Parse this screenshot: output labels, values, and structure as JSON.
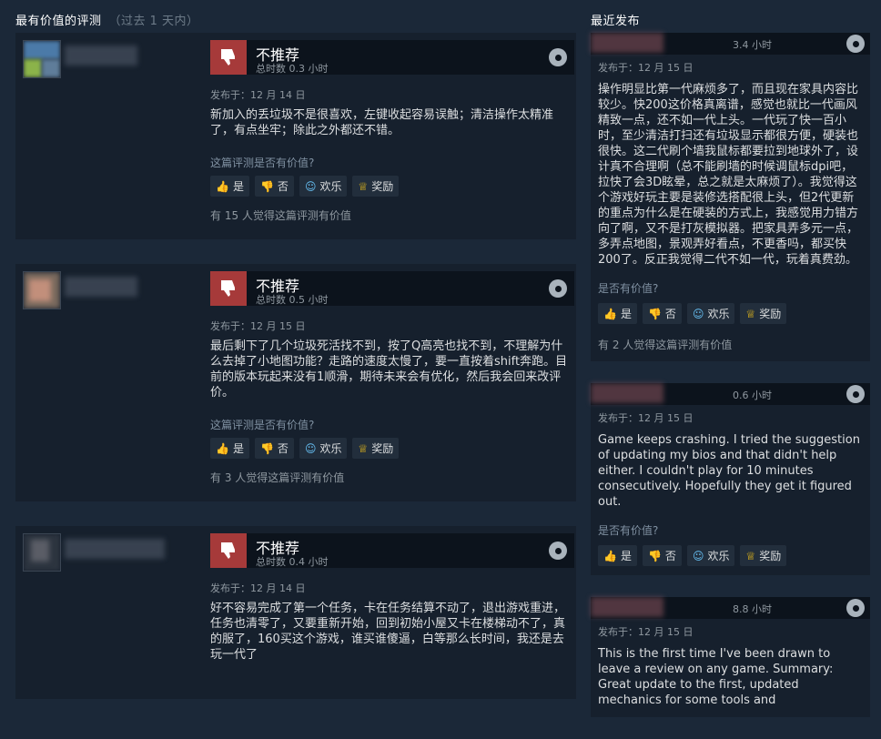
{
  "most_helpful": {
    "title": "最有价值的评测",
    "range": "（过去 1 天内）",
    "reviews": [
      {
        "verdict": "不推荐",
        "hours": "总时数 0.3 小时",
        "posted": "发布于：12 月 14 日",
        "text": "新加入的丢垃圾不是很喜欢，左键收起容易误触；清洁操作太精准了，有点坐牢；除此之外都还不错。",
        "found_helpful": "有 15 人觉得这篇评测有价值"
      },
      {
        "verdict": "不推荐",
        "hours": "总时数 0.5 小时",
        "posted": "发布于：12 月 15 日",
        "text": "最后剩下了几个垃圾死活找不到，按了Q高亮也找不到，不理解为什么去掉了小地图功能？走路的速度太慢了，要一直按着shift奔跑。目前的版本玩起来没有1顺滑，期待未来会有优化，然后我会回来改评价。",
        "found_helpful": "有 3 人觉得这篇评测有价值"
      },
      {
        "verdict": "不推荐",
        "hours": "总时数 0.4 小时",
        "posted": "发布于：12 月 14 日",
        "text": "好不容易完成了第一个任务，卡在任务结算不动了，退出游戏重进，任务也清零了，又要重新开始，回到初始小屋又卡在楼梯动不了，真的服了，160买这个游戏，谁买谁傻逼，白等那么长时间，我还是去玩一代了",
        "found_helpful": ""
      }
    ]
  },
  "recent": {
    "title": "最近发布",
    "reviews": [
      {
        "hours": "3.4 小时",
        "posted": "发布于：12 月 15 日",
        "text": "操作明显比第一代麻烦多了，而且现在家具内容比较少。快200这价格真离谱，感觉也就比一代画风精致一点，还不如一代上头。一代玩了快一百小时，至少清洁打扫还有垃圾显示都很方便，硬装也很快。这二代刷个墙我鼠标都要拉到地球外了，设计真不合理啊（总不能刷墙的时候调鼠标dpi吧，拉快了会3D眩晕，总之就是太麻烦了）。我觉得这个游戏好玩主要是装修选搭配很上头，但2代更新的重点为什么是在硬装的方式上，我感觉用力错方向了啊，又不是打灰模拟器。把家具弄多元一点，多弄点地图，景观弄好看点，不更香吗，都买快200了。反正我觉得二代不如一代，玩着真费劲。",
        "found_helpful": "有 2 人觉得这篇评测有价值"
      },
      {
        "hours": "0.6 小时",
        "posted": "发布于：12 月 15 日",
        "text": "Game keeps crashing. I tried the suggestion of updating my bios and that didn't help either. I couldn't play for 10 minutes consecutively. Hopefully they get it figured out.",
        "found_helpful": ""
      },
      {
        "hours": "8.8 小时",
        "posted": "发布于：12 月 15 日",
        "text": "This is the first time I've been drawn to leave a review on any game. Summary: Great update to the first, updated mechanics for some tools and",
        "found_helpful": ""
      }
    ]
  },
  "ui": {
    "helpful_question": "这篇评测是否有价值?",
    "helpful_question_short": "是否有价值?",
    "yes": "是",
    "no": "否",
    "funny": "欢乐",
    "award": "奖励"
  },
  "colors": {
    "background": "#1b2838",
    "card": "#16202d",
    "not_recommended": "#a63a3a",
    "link": "#67c1f5"
  }
}
